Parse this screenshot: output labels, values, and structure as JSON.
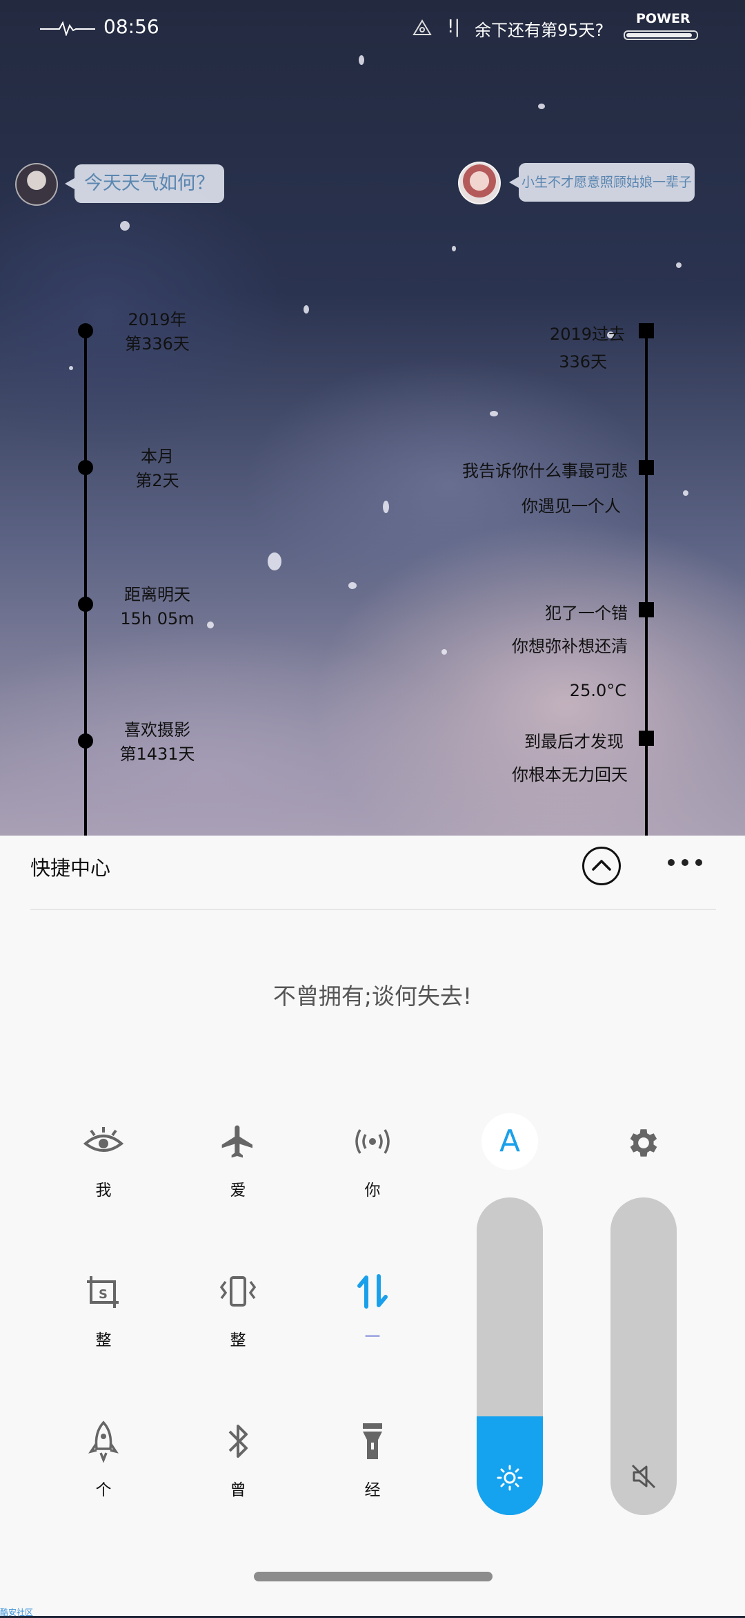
{
  "status_bar": {
    "time": "08:56",
    "countdown": "余下还有第95天?",
    "power_label": "POWER",
    "battery_level": 0.95,
    "alert_icon": "!|"
  },
  "chat": {
    "left_bubble": "今天天气如何？",
    "right_bubble": "小生不才愿意照顾姑娘一辈子"
  },
  "timeline_left": [
    {
      "line1": "2019年",
      "line2": "第336天"
    },
    {
      "line1": "本月",
      "line2": "第2天"
    },
    {
      "line1": "距离明天",
      "line2": "15h 05m"
    },
    {
      "line1": "喜欢摄影",
      "line2": "第1431天"
    }
  ],
  "timeline_right": [
    {
      "line1": "2019过去",
      "line2": "336天"
    },
    {
      "line1": "我告诉你什么事最可悲",
      "line2": "你遇见一个人"
    },
    {
      "line1": "犯了一个错",
      "line2": "你想弥补想还清"
    },
    {
      "line1": "25.0°C"
    },
    {
      "line1": "到最后才发现",
      "line2": "你根本无力回天"
    }
  ],
  "quick_center": {
    "title": "快捷中心",
    "motto": "不曾拥有;谈何失去!",
    "tiles": [
      {
        "label": "我",
        "icon": "eye-icon"
      },
      {
        "label": "爱",
        "icon": "airplane-icon"
      },
      {
        "label": "你",
        "icon": "hotspot-icon"
      },
      {
        "label": "整",
        "icon": "screenshot-icon"
      },
      {
        "label": "整",
        "icon": "vibrate-icon"
      },
      {
        "label": "—",
        "icon": "data-transfer-icon"
      },
      {
        "label": "个",
        "icon": "rocket-icon"
      },
      {
        "label": "曾",
        "icon": "bluetooth-icon"
      },
      {
        "label": "经",
        "icon": "flashlight-icon"
      }
    ],
    "auto_brightness_label": "A",
    "brightness_level": 0.31,
    "volume_level": 0.0,
    "accent_color": "#15a2ef"
  },
  "watermark": "酷安社区"
}
